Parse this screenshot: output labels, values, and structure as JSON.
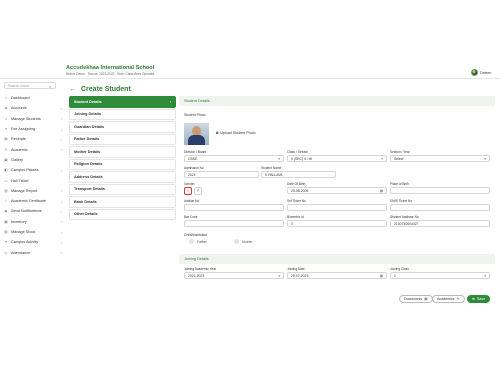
{
  "header": {
    "school_name": "Accudekhaa International School",
    "school_sub": "Brand: Demo · School: 2022-2023 · Role: Class Area Operator",
    "user_name": "Deleen"
  },
  "sidebar": {
    "search_placeholder": "Search menu",
    "items": [
      {
        "label": "Dashboard",
        "icon": "dashboard-icon",
        "glyph": "⌂",
        "has_children": false
      },
      {
        "label": "Accounts",
        "icon": "accounts-icon",
        "glyph": "◈",
        "has_children": true
      },
      {
        "label": "Manage Students",
        "icon": "students-icon",
        "glyph": "☺",
        "has_children": true
      },
      {
        "label": "Fee Assigning",
        "icon": "fee-icon",
        "glyph": "≡",
        "has_children": true
      },
      {
        "label": "Receipts",
        "icon": "receipt-icon",
        "glyph": "▤",
        "has_children": true
      },
      {
        "label": "Academic",
        "icon": "academic-icon",
        "glyph": "✎",
        "has_children": true
      },
      {
        "label": "Gallery",
        "icon": "gallery-icon",
        "glyph": "▣",
        "has_children": false
      },
      {
        "label": "Campus Passes",
        "icon": "pass-icon",
        "glyph": "◧",
        "has_children": true
      },
      {
        "label": "Hall Ticket",
        "icon": "ticket-icon",
        "glyph": "▭",
        "has_children": false
      },
      {
        "label": "Manage Report",
        "icon": "report-icon",
        "glyph": "▥",
        "has_children": true
      },
      {
        "label": "Academic Certificate",
        "icon": "certificate-icon",
        "glyph": "✓",
        "has_children": true
      },
      {
        "label": "Send Notifications",
        "icon": "bell-icon",
        "glyph": "◉",
        "has_children": true
      },
      {
        "label": "Inventory",
        "icon": "inventory-icon",
        "glyph": "▦",
        "has_children": true
      },
      {
        "label": "Manage Stock",
        "icon": "stock-icon",
        "glyph": "▧",
        "has_children": true
      },
      {
        "label": "Campus Activity",
        "icon": "activity-icon",
        "glyph": "✦",
        "has_children": true
      },
      {
        "label": "Attendance",
        "icon": "attendance-icon",
        "glyph": "◷",
        "has_children": true
      }
    ]
  },
  "page": {
    "title": "Create Student"
  },
  "steps": [
    {
      "label": "Student Details",
      "active": true
    },
    {
      "label": "Joining Details",
      "active": false
    },
    {
      "label": "Guardian Details",
      "active": false
    },
    {
      "label": "Father Details",
      "active": false
    },
    {
      "label": "Mother Details",
      "active": false
    },
    {
      "label": "Religion Details",
      "active": false
    },
    {
      "label": "Address Details",
      "active": false
    },
    {
      "label": "Transport Details",
      "active": false
    },
    {
      "label": "Bank Details",
      "active": false
    },
    {
      "label": "Other Details",
      "active": false
    }
  ],
  "student_details": {
    "section_title": "Student Details",
    "photo_label": "Student Photo",
    "upload_label": "Upload Student Photo",
    "division": {
      "label": "Division / Board",
      "value": "CBSE"
    },
    "class": {
      "label": "Class / Stream",
      "value": "9 (SEC) 4 / HI"
    },
    "section": {
      "label": "Section / Year",
      "value": "Select"
    },
    "admission_no": {
      "label": "Admission No",
      "value": "2024"
    },
    "student_name": {
      "label": "Student Name",
      "value": "K PALLAVA"
    },
    "gender": {
      "label": "Gender"
    },
    "dob": {
      "label": "Date Of Birth",
      "value": "25-08-2005"
    },
    "place_of_birth": {
      "label": "Place of Birth",
      "value": ""
    },
    "aadhar_no": {
      "label": "Aadhar No",
      "value": ""
    },
    "ssf_ticket_no": {
      "label": "Ssf Ticket No",
      "value": ""
    },
    "emis_ticket_no": {
      "label": "EMIS Ticket No",
      "value": ""
    },
    "bar_code": {
      "label": "Bar Code",
      "value": ""
    },
    "biometric_id": {
      "label": "Biometric Id",
      "value": "0"
    },
    "student_aadhaar": {
      "label": "Student Aadhaar No",
      "value": "2130730604027"
    },
    "child_in_institution": {
      "label": "Child/Institution"
    },
    "radio_father": "Father",
    "radio_mother": "Mother"
  },
  "joining_details": {
    "section_title": "Joining Details",
    "academic_year": {
      "label": "Joining Academic Year",
      "value": "2022-2023"
    },
    "joining_date": {
      "label": "Joining Date",
      "value": "25-07-2023"
    },
    "joining_class": {
      "label": "Joining Class",
      "value": "1"
    }
  },
  "actions": {
    "documents": "Documents",
    "academics": "Academics",
    "save": "Save"
  }
}
